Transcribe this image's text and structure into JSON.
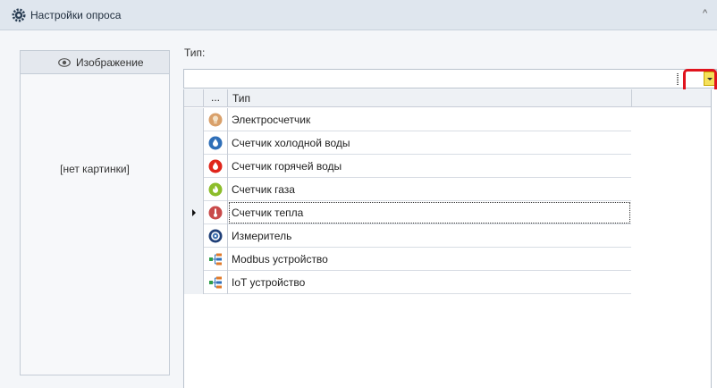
{
  "header": {
    "title": "Настройки опроса",
    "icon": "gear-icon",
    "collapse_glyph": "^"
  },
  "image_panel": {
    "tab_label": "Изображение",
    "tab_icon": "eye-icon",
    "empty_text": "[нет картинки]"
  },
  "type_field": {
    "label": "Тип:",
    "value": "",
    "dropdown_button_color": "#f5e05a",
    "highlight_color": "#e0141e"
  },
  "grid": {
    "header_dots": "...",
    "header_type": "Тип",
    "rows": [
      {
        "name": "Электросчетчик",
        "icon": "electricity-meter-icon",
        "color": "#d9a06a"
      },
      {
        "name": "Счетчик холодной воды",
        "icon": "cold-water-icon",
        "color": "#2f6fb8"
      },
      {
        "name": "Счетчик горячей воды",
        "icon": "hot-water-icon",
        "color": "#e0251b"
      },
      {
        "name": "Счетчик газа",
        "icon": "gas-meter-icon",
        "color": "#8cbd2a"
      },
      {
        "name": "Счетчик тепла",
        "icon": "heat-meter-icon",
        "color": "#c94a4a",
        "selected": true
      },
      {
        "name": "Измеритель",
        "icon": "gauge-icon",
        "color": "#1f3f78"
      },
      {
        "name": "Modbus устройство",
        "icon": "modbus-device-icon",
        "color": "#2f9e4a"
      },
      {
        "name": "IoT устройство",
        "icon": "iot-device-icon",
        "color": "#2f9e4a"
      }
    ]
  }
}
